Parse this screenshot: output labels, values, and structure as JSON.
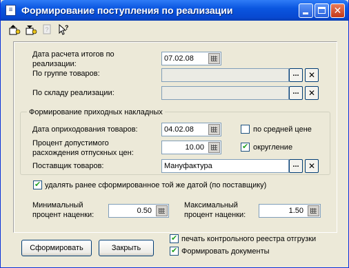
{
  "window": {
    "title": "Формирование поступления по реализации",
    "icon": "document-icon"
  },
  "toolbar": {
    "icons": [
      "save-icon",
      "load-icon",
      "help-icon",
      "context-help-icon"
    ]
  },
  "fields": {
    "calc_date_label": "Дата расчета итогов по реализации:",
    "calc_date_value": "07.02.08",
    "product_group_label": "По группе товаров:",
    "product_group_value": "",
    "warehouse_label": "По складу реализации:",
    "warehouse_value": ""
  },
  "group": {
    "title": "Формирование приходных накладных",
    "posting_date_label": "Дата оприходования товаров:",
    "posting_date_value": "04.02.08",
    "avg_price_label": "по средней цене",
    "avg_price_checked": false,
    "tolerance_label": "Процент допустимого расхождения отпускных цен:",
    "tolerance_value": "10.00",
    "rounding_label": "округление",
    "rounding_checked": true,
    "supplier_label": "Поставщик товаров:",
    "supplier_value": "Мануфактура"
  },
  "delete_prev": {
    "label": "удалять ранее сформированное той же датой (по поставщику)",
    "checked": true
  },
  "markup": {
    "min_label": "Минимальный процент наценки:",
    "min_value": "0.50",
    "max_label": "Максимальный процент наценки:",
    "max_value": "1.50"
  },
  "buttons": {
    "generate": "Сформировать",
    "close": "Закрыть"
  },
  "options": {
    "print_registry_label": "печать контрольного реестра отгрузки",
    "print_registry_checked": true,
    "generate_docs_label": "Формировать документы",
    "generate_docs_checked": true
  },
  "colors": {
    "titlebar": "#0a56e0",
    "dialog_bg": "#ece9d8",
    "check_mark": "#21a121"
  }
}
